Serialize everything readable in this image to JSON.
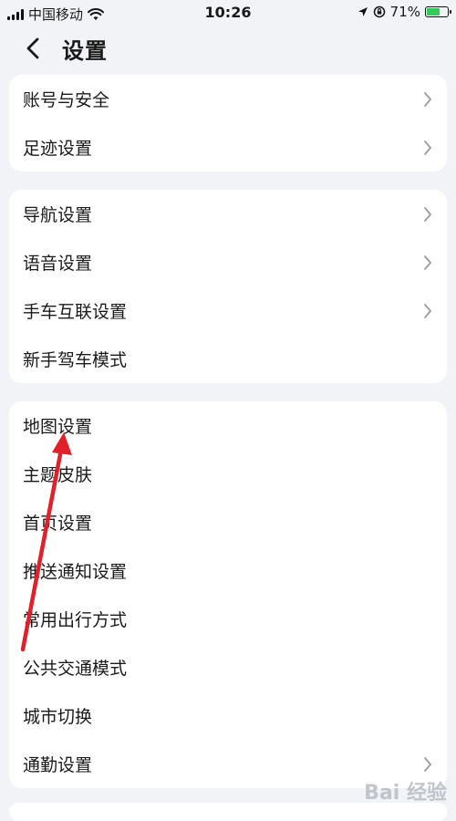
{
  "status_bar": {
    "carrier": "中国移动",
    "time": "10:26",
    "battery_percent": "71%",
    "battery_level": 0.71,
    "icons": [
      "signal-icon",
      "wifi-icon",
      "location-icon",
      "orientation-lock-icon",
      "battery-icon"
    ]
  },
  "nav": {
    "title": "设置",
    "back_icon": "back-chevron-icon"
  },
  "groups": [
    {
      "items": [
        {
          "label": "账号与安全",
          "chevron": true
        },
        {
          "label": "足迹设置",
          "chevron": true
        }
      ]
    },
    {
      "items": [
        {
          "label": "导航设置",
          "chevron": true
        },
        {
          "label": "语音设置",
          "chevron": true
        },
        {
          "label": "手车互联设置",
          "chevron": true
        },
        {
          "label": "新手驾车模式",
          "chevron": false
        }
      ]
    },
    {
      "items": [
        {
          "label": "地图设置",
          "chevron": false
        },
        {
          "label": "主题皮肤",
          "chevron": false
        },
        {
          "label": "首页设置",
          "chevron": false
        },
        {
          "label": "推送通知设置",
          "chevron": false
        },
        {
          "label": "常用出行方式",
          "chevron": false
        },
        {
          "label": "公共交通模式",
          "chevron": false
        },
        {
          "label": "城市切换",
          "chevron": false
        },
        {
          "label": "通勤设置",
          "chevron": true
        }
      ]
    }
  ],
  "annotation": {
    "color": "#e0202a",
    "points_to": "地图设置"
  },
  "watermark": "Bai 经验",
  "colors": {
    "background": "#f2f3f7",
    "card": "#ffffff",
    "chevron": "#9a9ca3",
    "battery": "#34c759"
  }
}
